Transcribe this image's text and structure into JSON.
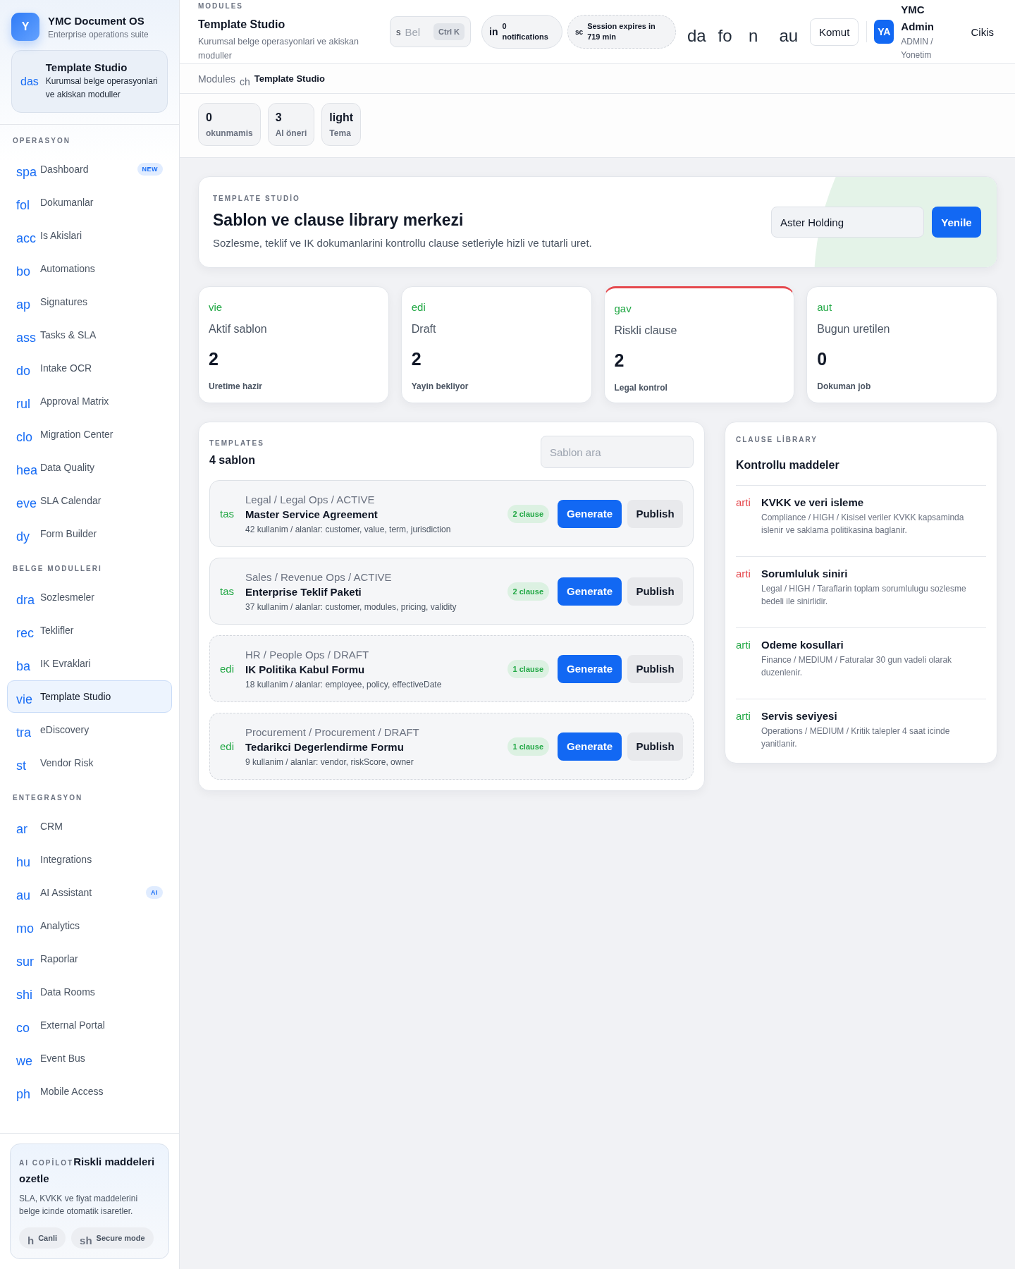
{
  "sidebar": {
    "brand": {
      "logo": "Y",
      "name": "YMC Document OS",
      "tagline": "Enterprise operations suite"
    },
    "current_module": {
      "icon": "das",
      "title": "Template Studio",
      "subtitle": "Kurumsal belge operasyonlari ve akiskan moduller"
    },
    "sections": [
      {
        "title": "OPERASYON",
        "items": [
          {
            "icon": "spa",
            "label": "Dashboard",
            "badge": "NEW",
            "selected": false
          },
          {
            "icon": "fol",
            "label": "Dokumanlar",
            "selected": false
          },
          {
            "icon": "acc",
            "label": "Is Akislari",
            "selected": false
          },
          {
            "icon": "bo",
            "label": "Automations",
            "selected": false
          },
          {
            "icon": "ap",
            "label": "Signatures",
            "selected": false
          },
          {
            "icon": "ass",
            "label": "Tasks & SLA",
            "selected": false
          },
          {
            "icon": "do",
            "label": "Intake OCR",
            "selected": false
          },
          {
            "icon": "rul",
            "label": "Approval Matrix",
            "selected": false
          },
          {
            "icon": "clo",
            "label": "Migration Center",
            "selected": false
          },
          {
            "icon": "hea",
            "label": "Data Quality",
            "selected": false
          },
          {
            "icon": "eve",
            "label": "SLA Calendar",
            "selected": false
          },
          {
            "icon": "dy",
            "label": "Form Builder",
            "selected": false
          }
        ]
      },
      {
        "title": "BELGE MODULLERI",
        "items": [
          {
            "icon": "dra",
            "label": "Sozlesmeler",
            "selected": false
          },
          {
            "icon": "rec",
            "label": "Teklifler",
            "selected": false
          },
          {
            "icon": "ba",
            "label": "IK Evraklari",
            "selected": false
          },
          {
            "icon": "vie",
            "label": "Template Studio",
            "selected": true
          },
          {
            "icon": "tra",
            "label": "eDiscovery",
            "selected": false
          },
          {
            "icon": "st",
            "label": "Vendor Risk",
            "selected": false
          }
        ]
      },
      {
        "title": "ENTEGRASYON",
        "items": [
          {
            "icon": "ar",
            "label": "CRM",
            "selected": false
          },
          {
            "icon": "hu",
            "label": "Integrations",
            "selected": false
          },
          {
            "icon": "au",
            "label": "AI Assistant",
            "badge": "AI",
            "selected": false
          },
          {
            "icon": "mo",
            "label": "Analytics",
            "selected": false
          },
          {
            "icon": "sur",
            "label": "Raporlar",
            "selected": false
          },
          {
            "icon": "shi",
            "label": "Data Rooms",
            "selected": false
          },
          {
            "icon": "co",
            "label": "External Portal",
            "selected": false
          },
          {
            "icon": "we",
            "label": "Event Bus",
            "selected": false
          },
          {
            "icon": "ph",
            "label": "Mobile Access",
            "selected": false
          }
        ]
      }
    ],
    "copilot": {
      "eyebrow": "AI COPİLOT",
      "title": "Riskli maddeleri ozetle",
      "text": "SLA, KVKK ve fiyat maddelerini belge icinde otomatik isaretler.",
      "chips": [
        {
          "icon": "h",
          "label": "Canli"
        },
        {
          "icon": "sh",
          "label": "Secure mode"
        }
      ]
    }
  },
  "topbar": {
    "eyebrow": "MODULES",
    "title": "Template Studio",
    "subtitle": "Kurumsal belge operasyonlari ve akiskan moduller",
    "search": {
      "icon": "s",
      "placeholder": "Bel",
      "shortcut": "Ctrl K"
    },
    "notifications": {
      "icon": "in",
      "count": "0",
      "label": "notifications"
    },
    "session": {
      "icon": "sc",
      "text": "Session expires in 719 min"
    },
    "icon_buttons": [
      "da",
      "fo",
      "n",
      "au"
    ],
    "command_button": "Komut",
    "user": {
      "initials": "YA",
      "name": "YMC Admin",
      "role": "ADMIN / Yonetim"
    },
    "logout": "Cikis"
  },
  "breadcrumb": {
    "items": [
      "Modules",
      "Template Studio"
    ],
    "separator": "ch"
  },
  "stats": [
    {
      "value": "0",
      "label": "okunmamis"
    },
    {
      "value": "3",
      "label": "AI öneri"
    },
    {
      "value": "light",
      "label": "Tema"
    }
  ],
  "hero": {
    "eyebrow": "TEMPLATE STUDİO",
    "title": "Sablon ve clause library merkezi",
    "description": "Sozlesme, teklif ve IK dokumanlarini kontrollu clause setleriyle hizli ve tutarli uret.",
    "company": "Aster Holding",
    "button": "Yenile"
  },
  "kpis": [
    {
      "icon": "vie",
      "label": "Aktif sablon",
      "value": "2",
      "note": "Uretime hazir",
      "alert": false
    },
    {
      "icon": "edi",
      "label": "Draft",
      "value": "2",
      "note": "Yayin bekliyor",
      "alert": false
    },
    {
      "icon": "gav",
      "label": "Riskli clause",
      "value": "2",
      "note": "Legal kontrol",
      "alert": true
    },
    {
      "icon": "aut",
      "label": "Bugun uretilen",
      "value": "0",
      "note": "Dokuman job",
      "alert": false
    }
  ],
  "templates": {
    "eyebrow": "TEMPLATES",
    "count": "4 sablon",
    "search": {
      "placeholder": "Sablon ara"
    },
    "rows": [
      {
        "icon": "tas",
        "meta": "Legal / Legal Ops / ACTIVE",
        "title": "Master Service Agreement",
        "detail": "42 kullanim / alanlar: customer, value, term, jurisdiction",
        "clauses": "2 clause",
        "draft": false,
        "actions": [
          {
            "label": "Generate",
            "kind": "primary"
          },
          {
            "label": "Publish",
            "kind": "secondary"
          }
        ]
      },
      {
        "icon": "tas",
        "meta": "Sales / Revenue Ops / ACTIVE",
        "title": "Enterprise Teklif Paketi",
        "detail": "37 kullanim / alanlar: customer, modules, pricing, validity",
        "clauses": "2 clause",
        "draft": false,
        "actions": [
          {
            "label": "Generate",
            "kind": "primary"
          },
          {
            "label": "Publish",
            "kind": "secondary"
          }
        ]
      },
      {
        "icon": "edi",
        "meta": "HR / People Ops / DRAFT",
        "title": "IK Politika Kabul Formu",
        "detail": "18 kullanim / alanlar: employee, policy, effectiveDate",
        "clauses": "1 clause",
        "draft": true,
        "actions": [
          {
            "label": "Generate",
            "kind": "primary"
          },
          {
            "label": "Publish",
            "kind": "secondary"
          }
        ]
      },
      {
        "icon": "edi",
        "meta": "Procurement / Procurement / DRAFT",
        "title": "Tedarikci Degerlendirme Formu",
        "detail": "9 kullanim / alanlar: vendor, riskScore, owner",
        "clauses": "1 clause",
        "draft": true,
        "actions": [
          {
            "label": "Generate",
            "kind": "primary"
          },
          {
            "label": "Publish",
            "kind": "secondary"
          }
        ]
      }
    ]
  },
  "clause_library": {
    "eyebrow": "CLAUSE LİBRARY",
    "title": "Kontrollu maddeler",
    "items": [
      {
        "icon": "arti",
        "color": "#e5484d",
        "title": "KVKK ve veri isleme",
        "description": "Compliance / HIGH / Kisisel veriler KVKK kapsaminda islenir ve saklama politikasina baglanir."
      },
      {
        "icon": "arti",
        "color": "#e5484d",
        "title": "Sorumluluk siniri",
        "description": "Legal / HIGH / Taraflarin toplam sorumlulugu sozlesme bedeli ile sinirlidir."
      },
      {
        "icon": "arti",
        "color": "#22a845",
        "title": "Odeme kosullari",
        "description": "Finance / MEDIUM / Faturalar 30 gun vadeli olarak duzenlenir."
      },
      {
        "icon": "arti",
        "color": "#22a845",
        "title": "Servis seviyesi",
        "description": "Operations / MEDIUM / Kritik talepler 4 saat icinde yanitlanir."
      }
    ]
  }
}
